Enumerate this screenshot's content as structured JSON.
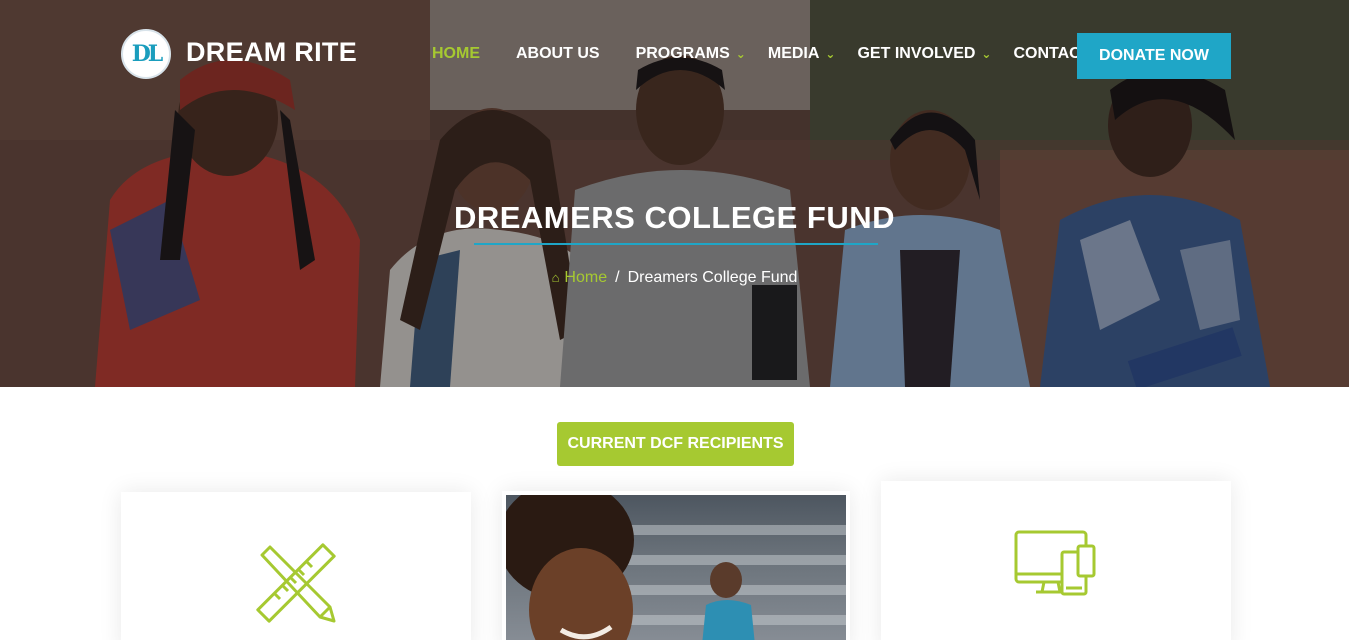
{
  "brand": {
    "name": "DREAM RITE",
    "logo_letters": "DL"
  },
  "nav": {
    "items": [
      {
        "label": "HOME",
        "active": true,
        "has_dropdown": false
      },
      {
        "label": "ABOUT US",
        "active": false,
        "has_dropdown": false
      },
      {
        "label": "PROGRAMS",
        "active": false,
        "has_dropdown": true
      },
      {
        "label": "MEDIA",
        "active": false,
        "has_dropdown": true
      },
      {
        "label": "GET INVOLVED",
        "active": false,
        "has_dropdown": true
      },
      {
        "label": "CONTACT",
        "active": false,
        "has_dropdown": false
      }
    ],
    "donate_label": "DONATE NOW"
  },
  "hero": {
    "title": "DREAMERS COLLEGE FUND",
    "breadcrumb_home": "Home",
    "breadcrumb_separator": "/",
    "breadcrumb_current": "Dreamers College Fund"
  },
  "content": {
    "recipients_button": "CURRENT DCF RECIPIENTS",
    "cards": [
      {
        "icon": "pencil-ruler-icon"
      },
      {
        "icon": "student-photo"
      },
      {
        "icon": "devices-icon"
      }
    ]
  },
  "colors": {
    "accent_green": "#a6c931",
    "accent_blue": "#1fa6c7"
  }
}
